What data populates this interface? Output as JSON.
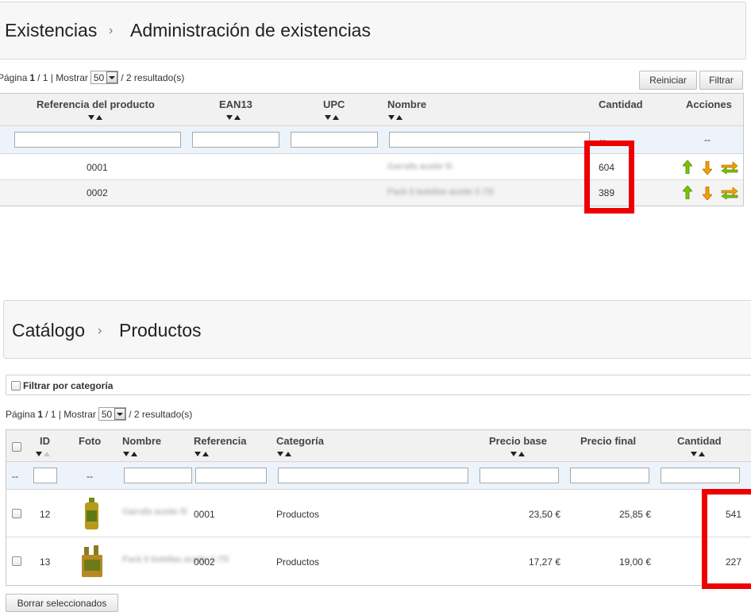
{
  "stock": {
    "breadcrumb": [
      "Existencias",
      "Administración de existencias"
    ],
    "separator": "›",
    "pagination": {
      "page_label": "Página",
      "page": "1",
      "of": "/ 1 | Mostrar",
      "per_page": "50",
      "results": "/ 2 resultado(s)"
    },
    "buttons": {
      "reset": "Reiniciar",
      "filter": "Filtrar"
    },
    "columns": [
      "Referencia del producto",
      "EAN13",
      "UPC",
      "Nombre",
      "Cantidad",
      "Acciones"
    ],
    "filter_dash": "--",
    "rows": [
      {
        "reference": "0001",
        "name": "Garrafa aceite 5l",
        "quantity": "604"
      },
      {
        "reference": "0002",
        "name": "Pack 6 botellas aceite 0.75l",
        "quantity": "389"
      }
    ]
  },
  "catalog": {
    "breadcrumb": [
      "Catálogo",
      "Productos"
    ],
    "separator": "›",
    "filter_by_category": "Filtrar por categoría",
    "pagination": {
      "page_label": "Página",
      "page": "1",
      "of": "/ 1 | Mostrar",
      "per_page": "50",
      "results": "/ 2 resultado(s)"
    },
    "columns": [
      "ID",
      "Foto",
      "Nombre",
      "Referencia",
      "Categoría",
      "Precio base",
      "Precio final",
      "Cantidad"
    ],
    "filter_dash": "--",
    "rows": [
      {
        "id": "12",
        "name": "Garrafa aceite 5l",
        "reference": "0001",
        "category": "Productos",
        "base_price": "23,50 €",
        "final_price": "25,85 €",
        "quantity": "541"
      },
      {
        "id": "13",
        "name": "Pack 6 botellas aceite 0.75l",
        "reference": "0002",
        "category": "Productos",
        "base_price": "17,27 €",
        "final_price": "19,00 €",
        "quantity": "227"
      }
    ],
    "delete_selected": "Borrar seleccionados"
  },
  "colors": {
    "highlight": "#ee0000",
    "arrow_up": "#7cc400",
    "arrow_down": "#f0a000"
  }
}
